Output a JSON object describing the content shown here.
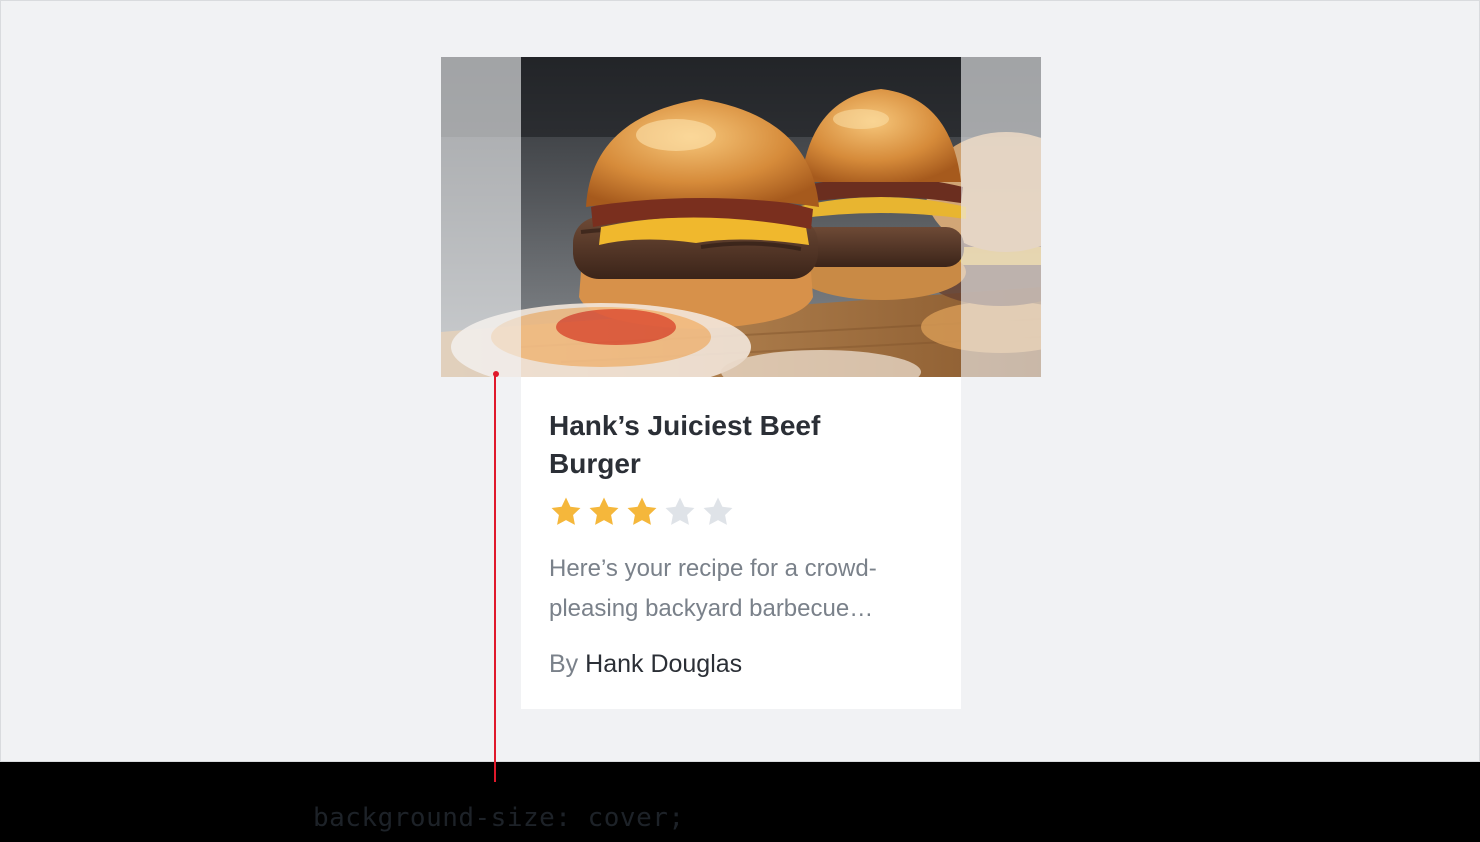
{
  "card": {
    "image_alt": "Beef burgers with bacon and cheese on a wooden board",
    "title": "Hank’s Juiciest Beef Burger",
    "rating": {
      "value": 3,
      "max": 5
    },
    "description": "Here’s your recipe for a crowd-pleasing backyard barbecue…",
    "byline_prefix": "By",
    "author": "Hank Douglas"
  },
  "annotation": {
    "code": "background-size: cover;"
  },
  "colors": {
    "stage_background": "#f1f2f4",
    "footer_background": "#000000",
    "star_filled": "#f5b73b",
    "star_empty": "#dfe3e8",
    "callout": "#e0192b",
    "title_text": "#2b2f36",
    "muted_text": "#7a818a"
  }
}
